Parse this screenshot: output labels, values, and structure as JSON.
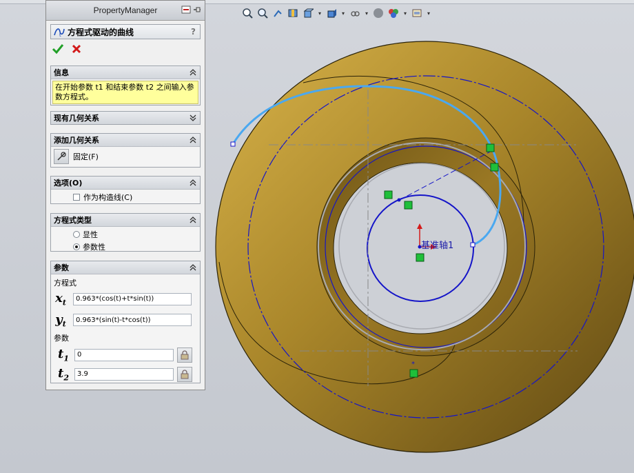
{
  "panel": {
    "title": "PropertyManager",
    "feature_name": "方程式驱动的曲线",
    "help": "?"
  },
  "info": {
    "title": "信息",
    "message": "在开始参数 t1 和结束参数 t2 之间输入参数方程式。"
  },
  "existing_relations": {
    "title": "现有几何关系"
  },
  "add_relations": {
    "title": "添加几何关系",
    "fix_label": "固定(F)"
  },
  "options": {
    "title": "选项(O)",
    "construction_label": "作为构造线(C)",
    "construction_checked": false
  },
  "equation_type": {
    "title": "方程式类型",
    "options": [
      "显性",
      "参数性"
    ],
    "selected": "参数性"
  },
  "parameters": {
    "title": "参数",
    "equation_heading": "方程式",
    "x_symbol": "x",
    "x_sub": "t",
    "x_value": "0.963*(cos(t)+t*sin(t))",
    "y_symbol": "y",
    "y_sub": "t",
    "y_value": "0.963*(sin(t)-t*cos(t))",
    "param_heading": "参数",
    "t1_symbol": "t",
    "t1_sub": "1",
    "t1_value": "0",
    "t2_symbol": "t",
    "t2_sub": "2",
    "t2_value": "3.9"
  },
  "viewport": {
    "axis_label": "基准轴1"
  },
  "colors": {
    "part_gold": "#b8922a",
    "sketch_blue": "#1414c8",
    "curve_lightblue": "#4aa8f0",
    "relation_green": "#1fbf3a"
  }
}
